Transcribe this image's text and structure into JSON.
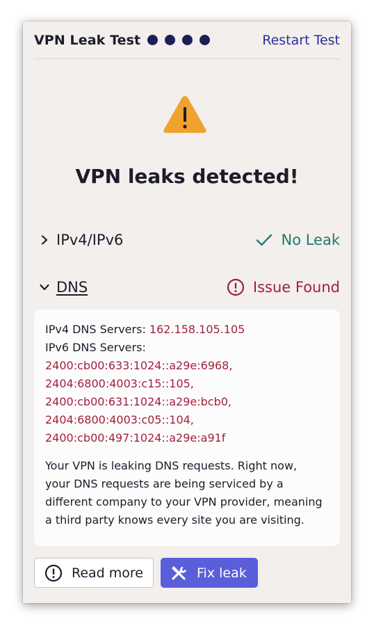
{
  "header": {
    "title": "VPN Leak Test",
    "progress": "4 of 4 steps complete",
    "restart_label": "Restart Test"
  },
  "result": {
    "headline": "VPN leaks detected!"
  },
  "sections": [
    {
      "label": "IPv4/IPv6",
      "status": "No Leak",
      "expanded": false,
      "status_color": "#1f7a6e"
    },
    {
      "label": "DNS",
      "status": "Issue Found",
      "expanded": true,
      "status_color": "#a21f3c"
    }
  ],
  "dns_details": {
    "ipv4_label": "IPv4 DNS Servers:",
    "ipv4_value": "162.158.105.105",
    "ipv6_label": "IPv6 DNS Servers:",
    "ipv6_values": [
      "2400:cb00:633:1024::a29e:6968,",
      "2404:6800:4003:c15::105,",
      "2400:cb00:631:1024::a29e:bcb0,",
      "2404:6800:4003:c05::104,",
      "2400:cb00:497:1024::a29e:a91f"
    ],
    "explanation_lines": [
      "Your VPN is leaking DNS requests. Right now,",
      "your DNS requests are being serviced by a",
      "different company to your VPN provider, meaning",
      "a third party knows every site you are visiting."
    ]
  },
  "actions": {
    "read_more_label": "Read more",
    "fix_leak_label": "Fix leak"
  },
  "colors": {
    "accent": "#5b5ed9",
    "danger": "#a21f3c",
    "success": "#1f7a6e",
    "warning": "#f0a22e",
    "step_dot": "#1b1f55"
  }
}
